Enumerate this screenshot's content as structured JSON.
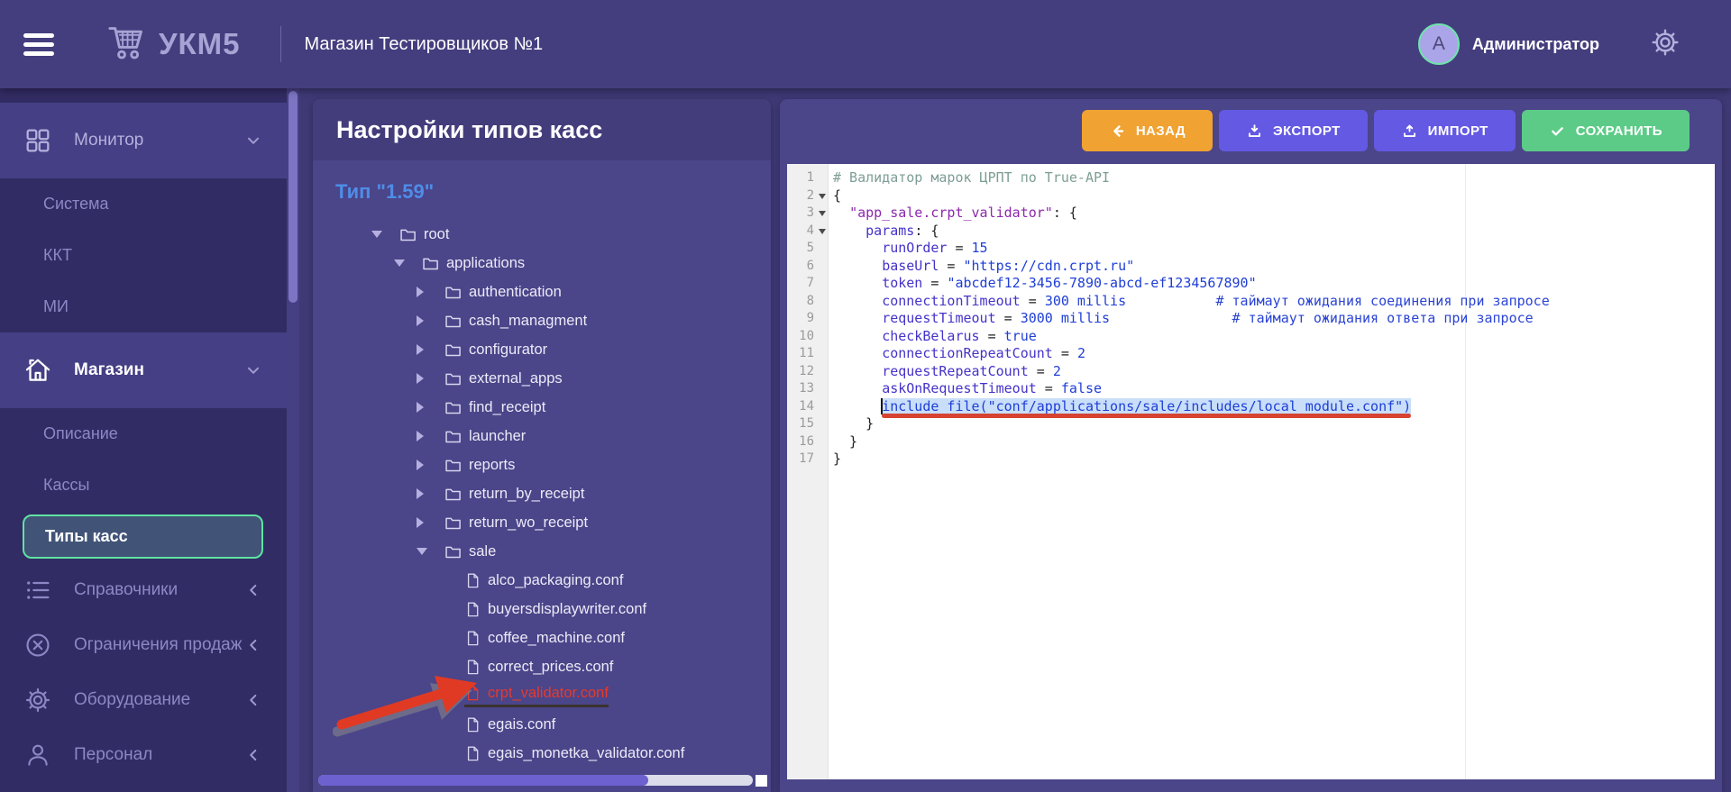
{
  "header": {
    "app_name": "УКМ5",
    "store_title": "Магазин Тестировщиков №1",
    "user": {
      "initial": "А",
      "name": "Администратор"
    }
  },
  "sidebar": {
    "sections": [
      {
        "label": "Монитор",
        "icon": "grid-icon",
        "state": "open",
        "active": false,
        "items": [
          {
            "label": "Система"
          },
          {
            "label": "ККТ"
          },
          {
            "label": "МИ"
          }
        ]
      },
      {
        "label": "Магазин",
        "icon": "home-icon",
        "state": "open",
        "active": true,
        "items": [
          {
            "label": "Описание"
          },
          {
            "label": "Кассы"
          },
          {
            "label": "Типы касс",
            "selected": true
          }
        ]
      },
      {
        "label": "Справочники",
        "icon": "list-icon",
        "state": "collapsed",
        "items": []
      },
      {
        "label": "Ограничения продаж",
        "icon": "ban-icon",
        "state": "collapsed",
        "items": []
      },
      {
        "label": "Оборудование",
        "icon": "gear-icon",
        "state": "collapsed",
        "items": []
      },
      {
        "label": "Персонал",
        "icon": "person-icon",
        "state": "collapsed",
        "items": []
      }
    ]
  },
  "panel": {
    "title": "Настройки типов касс",
    "type_label": "Тип \"1.59\"",
    "tree": [
      {
        "label": "root",
        "level": 1,
        "kind": "folder",
        "state": "expanded"
      },
      {
        "label": "applications",
        "level": 2,
        "kind": "folder",
        "state": "expanded"
      },
      {
        "label": "authentication",
        "level": 3,
        "kind": "folder",
        "state": "collapsed"
      },
      {
        "label": "cash_managment",
        "level": 3,
        "kind": "folder",
        "state": "collapsed"
      },
      {
        "label": "configurator",
        "level": 3,
        "kind": "folder",
        "state": "collapsed"
      },
      {
        "label": "external_apps",
        "level": 3,
        "kind": "folder",
        "state": "collapsed"
      },
      {
        "label": "find_receipt",
        "level": 3,
        "kind": "folder",
        "state": "collapsed"
      },
      {
        "label": "launcher",
        "level": 3,
        "kind": "folder",
        "state": "collapsed"
      },
      {
        "label": "reports",
        "level": 3,
        "kind": "folder",
        "state": "collapsed"
      },
      {
        "label": "return_by_receipt",
        "level": 3,
        "kind": "folder",
        "state": "collapsed"
      },
      {
        "label": "return_wo_receipt",
        "level": 3,
        "kind": "folder",
        "state": "collapsed"
      },
      {
        "label": "sale",
        "level": 3,
        "kind": "folder",
        "state": "expanded"
      },
      {
        "label": "alco_packaging.conf",
        "level": 4,
        "kind": "file"
      },
      {
        "label": "buyersdisplaywriter.conf",
        "level": 4,
        "kind": "file"
      },
      {
        "label": "coffee_machine.conf",
        "level": 4,
        "kind": "file"
      },
      {
        "label": "correct_prices.conf",
        "level": 4,
        "kind": "file"
      },
      {
        "label": "crpt_validator.conf",
        "level": 4,
        "kind": "file",
        "highlight": true
      },
      {
        "label": "egais.conf",
        "level": 4,
        "kind": "file"
      },
      {
        "label": "egais_monetka_validator.conf",
        "level": 4,
        "kind": "file"
      }
    ]
  },
  "editor": {
    "toolbar": [
      {
        "label": "НАЗАД",
        "icon": "arrow-left-icon",
        "color": "#f0a232"
      },
      {
        "label": "ЭКСПОРТ",
        "icon": "download-icon",
        "color": "#6459e3"
      },
      {
        "label": "ИМПОРТ",
        "icon": "upload-icon",
        "color": "#6459e3"
      },
      {
        "label": "СОХРАНИТЬ",
        "icon": "check-icon",
        "color": "#5ccb87"
      }
    ],
    "code": {
      "lines": [
        {
          "num": 1,
          "segments": [
            [
              "comment",
              "# Валидатор марок ЦРПТ по True-API"
            ]
          ]
        },
        {
          "num": 2,
          "fold": true,
          "segments": [
            [
              "plain",
              "{"
            ]
          ]
        },
        {
          "num": 3,
          "fold": true,
          "segments": [
            [
              "plain",
              "  "
            ],
            [
              "key",
              "\"app_sale.crpt_validator\""
            ],
            [
              "plain",
              ": {"
            ]
          ]
        },
        {
          "num": 4,
          "fold": true,
          "segments": [
            [
              "plain",
              "    "
            ],
            [
              "ident",
              "params"
            ],
            [
              "plain",
              ": {"
            ]
          ]
        },
        {
          "num": 5,
          "segments": [
            [
              "plain",
              "      "
            ],
            [
              "ident",
              "runOrder"
            ],
            [
              "plain",
              " = "
            ],
            [
              "val",
              "15"
            ]
          ]
        },
        {
          "num": 6,
          "segments": [
            [
              "plain",
              "      "
            ],
            [
              "ident",
              "baseUrl"
            ],
            [
              "plain",
              " = "
            ],
            [
              "val",
              "\"https://cdn.crpt.ru\""
            ]
          ]
        },
        {
          "num": 7,
          "segments": [
            [
              "plain",
              "      "
            ],
            [
              "ident",
              "token"
            ],
            [
              "plain",
              " = "
            ],
            [
              "val",
              "\"abcdef12-3456-7890-abcd-ef1234567890\""
            ]
          ]
        },
        {
          "num": 8,
          "segments": [
            [
              "plain",
              "      "
            ],
            [
              "ident",
              "connectionTimeout"
            ],
            [
              "plain",
              " = "
            ],
            [
              "val",
              "300 millis"
            ],
            [
              "plain",
              "           "
            ],
            [
              "comment2",
              "# таймаут ожидания соединения при запросе"
            ]
          ]
        },
        {
          "num": 9,
          "segments": [
            [
              "plain",
              "      "
            ],
            [
              "ident",
              "requestTimeout"
            ],
            [
              "plain",
              " = "
            ],
            [
              "val",
              "3000 millis"
            ],
            [
              "plain",
              "               "
            ],
            [
              "comment2",
              "# таймаут ожидания ответа при запросе"
            ]
          ]
        },
        {
          "num": 10,
          "segments": [
            [
              "plain",
              "      "
            ],
            [
              "ident",
              "checkBelarus"
            ],
            [
              "plain",
              " = "
            ],
            [
              "val",
              "true"
            ]
          ]
        },
        {
          "num": 11,
          "segments": [
            [
              "plain",
              "      "
            ],
            [
              "ident",
              "connectionRepeatCount"
            ],
            [
              "plain",
              " = "
            ],
            [
              "val",
              "2"
            ]
          ]
        },
        {
          "num": 12,
          "segments": [
            [
              "plain",
              "      "
            ],
            [
              "ident",
              "requestRepeatCount"
            ],
            [
              "plain",
              " = "
            ],
            [
              "val",
              "2"
            ]
          ]
        },
        {
          "num": 13,
          "segments": [
            [
              "plain",
              "      "
            ],
            [
              "ident",
              "askOnRequestTimeout"
            ],
            [
              "plain",
              " = "
            ],
            [
              "val",
              "false"
            ]
          ]
        },
        {
          "num": 14,
          "selected": true,
          "segments": [
            [
              "plain",
              "      "
            ],
            [
              "sel",
              "include file(\"conf/applications/sale/includes/local_module.conf\")"
            ]
          ]
        },
        {
          "num": 15,
          "segments": [
            [
              "plain",
              "    }"
            ]
          ]
        },
        {
          "num": 16,
          "segments": [
            [
              "plain",
              "  }"
            ]
          ]
        },
        {
          "num": 17,
          "segments": [
            [
              "plain",
              "}"
            ]
          ]
        }
      ]
    }
  },
  "colors": {
    "accent_green": "#5fe3a1",
    "file_highlight_red": "#e8392b",
    "selection_blue": "#c8def9",
    "underline_red": "#d64330",
    "type_label_blue": "#4e8de8"
  }
}
